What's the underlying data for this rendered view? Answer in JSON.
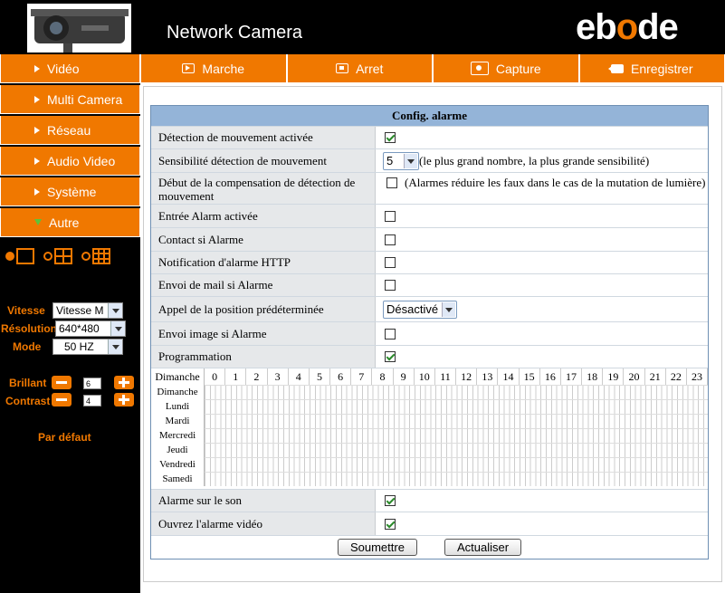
{
  "header": {
    "title": "Network Camera",
    "brand_pre": "eb",
    "brand_o": "o",
    "brand_post": "de"
  },
  "toolbar": {
    "play": "Marche",
    "stop": "Arret",
    "capture": "Capture",
    "record": "Enregistrer"
  },
  "sidebar": {
    "items": [
      "Vidéo",
      "Multi Camera",
      "Réseau",
      "Audio Video",
      "Système",
      "Autre"
    ],
    "vitesse_label": "Vitesse",
    "vitesse_value": "Vitesse M",
    "resolution_label": "Résolution",
    "resolution_value": "640*480",
    "mode_label": "Mode",
    "mode_value": "50 HZ",
    "brillant_label": "Brillant",
    "brillant_value": "6",
    "contrast_label": "Contrast",
    "contrast_value": "4",
    "default_link": "Par défaut"
  },
  "config": {
    "title": "Config. alarme",
    "motion_enabled": "Détection de mouvement activée",
    "sensitivity": "Sensibilité détection de mouvement",
    "sensitivity_value": "5",
    "sensitivity_hint": "(le plus grand nombre, la plus grande sensibilité)",
    "compensation": "Début de la compensation de détection de mouvement",
    "compensation_hint": "(Alarmes réduire les faux dans le cas de la mutation de lumière)",
    "alarm_input": "Entrée Alarm activée",
    "contact": "Contact si Alarme",
    "http_notif": "Notification d'alarme HTTP",
    "mail": "Envoi de mail si Alarme",
    "preset": "Appel de la position prédéterminée",
    "preset_value": "Désactivé",
    "image": "Envoi image si Alarme",
    "schedule": "Programmation",
    "sound": "Alarme sur le son",
    "video": "Ouvrez l'alarme vidéo",
    "submit": "Soumettre",
    "refresh": "Actualiser"
  },
  "schedule": {
    "corner": "Dimanche",
    "hours": [
      "0",
      "1",
      "2",
      "3",
      "4",
      "5",
      "6",
      "7",
      "8",
      "9",
      "10",
      "11",
      "12",
      "13",
      "14",
      "15",
      "16",
      "17",
      "18",
      "19",
      "20",
      "21",
      "22",
      "23"
    ],
    "days": [
      "Dimanche",
      "Lundi",
      "Mardi",
      "Mercredi",
      "Jeudi",
      "Vendredi",
      "Samedi"
    ]
  }
}
